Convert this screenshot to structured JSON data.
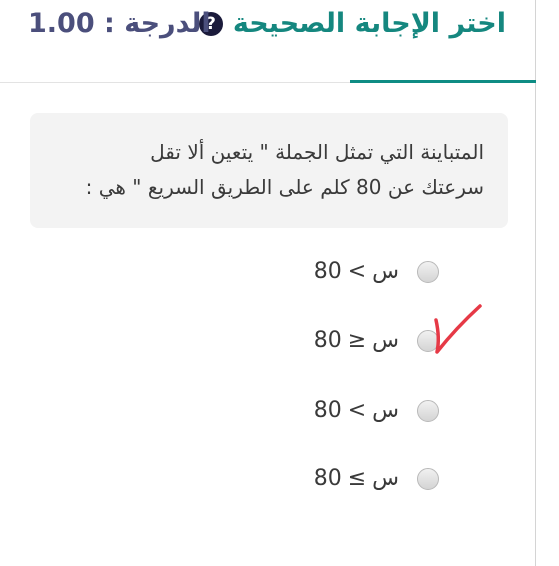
{
  "header": {
    "title": "اختر الإجابة الصحيحة",
    "help_icon": "question-circle-icon",
    "grade": "الدرجة : 1.00"
  },
  "question": {
    "line1": "المتباينة التي تمثل الجملة \" يتعين ألا تقل",
    "line2": "سرعتك عن 80 كلم على الطريق السريع \" هي :"
  },
  "options": [
    {
      "variable": "س",
      "symbol": "<",
      "number": "80",
      "selected": false
    },
    {
      "variable": "س",
      "symbol": "≥",
      "number": "80",
      "selected": false
    },
    {
      "variable": "س",
      "symbol": "<",
      "number": "80",
      "selected": false
    },
    {
      "variable": "س",
      "symbol": "≤",
      "number": "80",
      "selected": false
    }
  ],
  "annotation": {
    "icon": "red-checkmark-icon",
    "color": "#e63946"
  },
  "colors": {
    "accent": "#15877f",
    "grade": "#4b4f7c"
  }
}
